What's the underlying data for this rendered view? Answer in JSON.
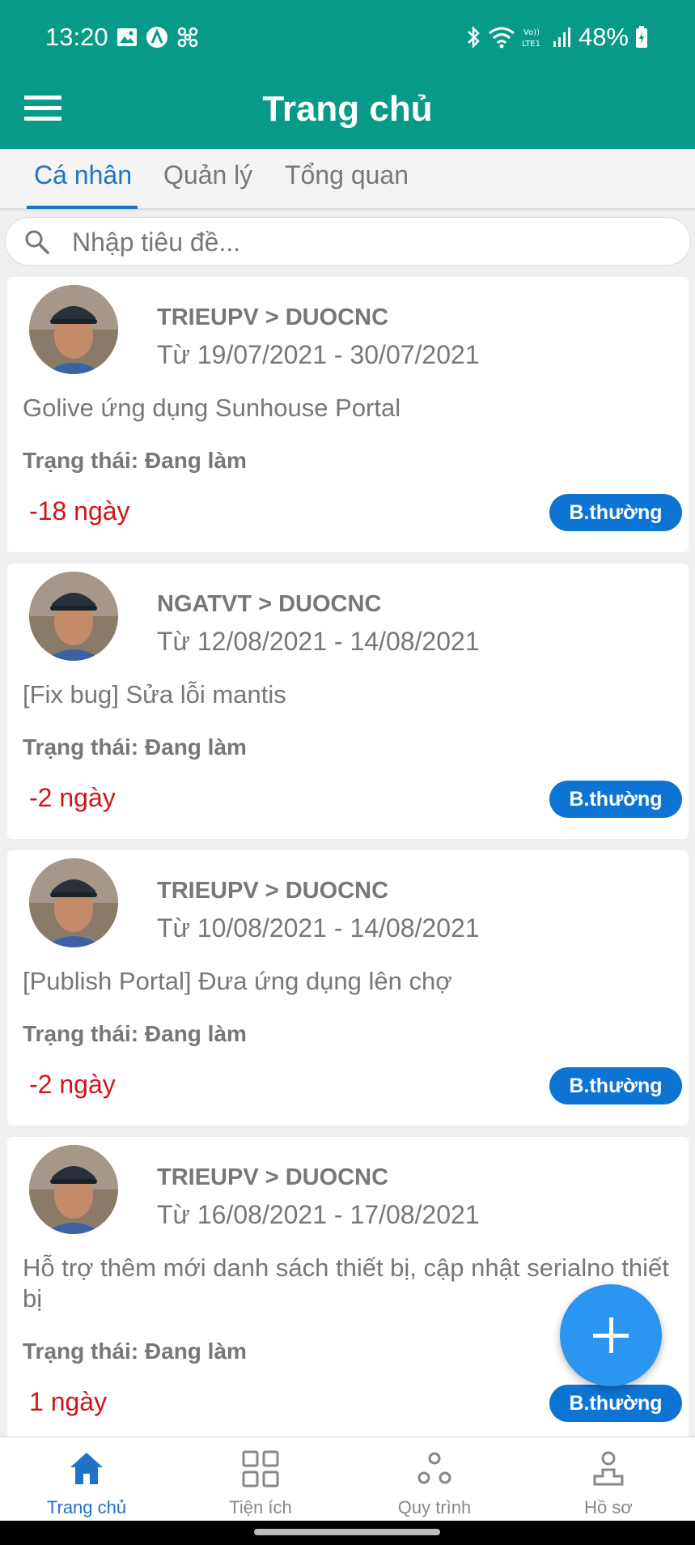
{
  "status_bar": {
    "time": "13:20",
    "battery": "48%",
    "icons": [
      "gallery-icon",
      "app-a-icon",
      "fan-icon",
      "bluetooth-icon",
      "wifi-icon",
      "volte-icon",
      "signal-icon",
      "battery-charging-icon"
    ]
  },
  "app_bar": {
    "title": "Trang chủ",
    "menu_icon": "hamburger-icon"
  },
  "tabs": [
    {
      "label": "Cá nhân",
      "active": true
    },
    {
      "label": "Quản lý",
      "active": false
    },
    {
      "label": "Tổng quan",
      "active": false
    }
  ],
  "search": {
    "placeholder": "Nhập tiêu đề...",
    "value": ""
  },
  "tasks": [
    {
      "route": "TRIEUPV > DUOCNC",
      "dates": "Từ 19/07/2021 - 30/07/2021",
      "name": "Golive ứng dụng Sunhouse Portal",
      "status": "Trạng thái: Đang làm",
      "days": "-18 ngày",
      "priority": "B.thường"
    },
    {
      "route": "NGATVT > DUOCNC",
      "dates": "Từ 12/08/2021 - 14/08/2021",
      "name": "[Fix bug] Sửa lỗi mantis",
      "status": "Trạng thái: Đang làm",
      "days": "-2 ngày",
      "priority": "B.thường"
    },
    {
      "route": "TRIEUPV > DUOCNC",
      "dates": "Từ 10/08/2021 - 14/08/2021",
      "name": "[Publish Portal] Đưa ứng dụng lên chợ",
      "status": "Trạng thái: Đang làm",
      "days": "-2 ngày",
      "priority": "B.thường"
    },
    {
      "route": "TRIEUPV > DUOCNC",
      "dates": "Từ 16/08/2021 - 17/08/2021",
      "name": "Hỗ trợ thêm mới danh sách thiết bị, cập nhật serialno thiết bị",
      "status": "Trạng thái: Đang làm",
      "days": "1 ngày",
      "priority": "B.thường"
    }
  ],
  "fab": {
    "icon": "plus-icon"
  },
  "bottom_nav": [
    {
      "label": "Trang chủ",
      "icon": "home-icon",
      "active": true
    },
    {
      "label": "Tiện ích",
      "icon": "grid-icon",
      "active": false
    },
    {
      "label": "Quy trình",
      "icon": "workflow-icon",
      "active": false
    },
    {
      "label": "Hồ sơ",
      "icon": "profile-icon",
      "active": false
    }
  ],
  "colors": {
    "header": "#079a88",
    "accent": "#1f73c6",
    "badge": "#0e74d4",
    "overdue": "#d0141c",
    "fab": "#2b96f1"
  }
}
